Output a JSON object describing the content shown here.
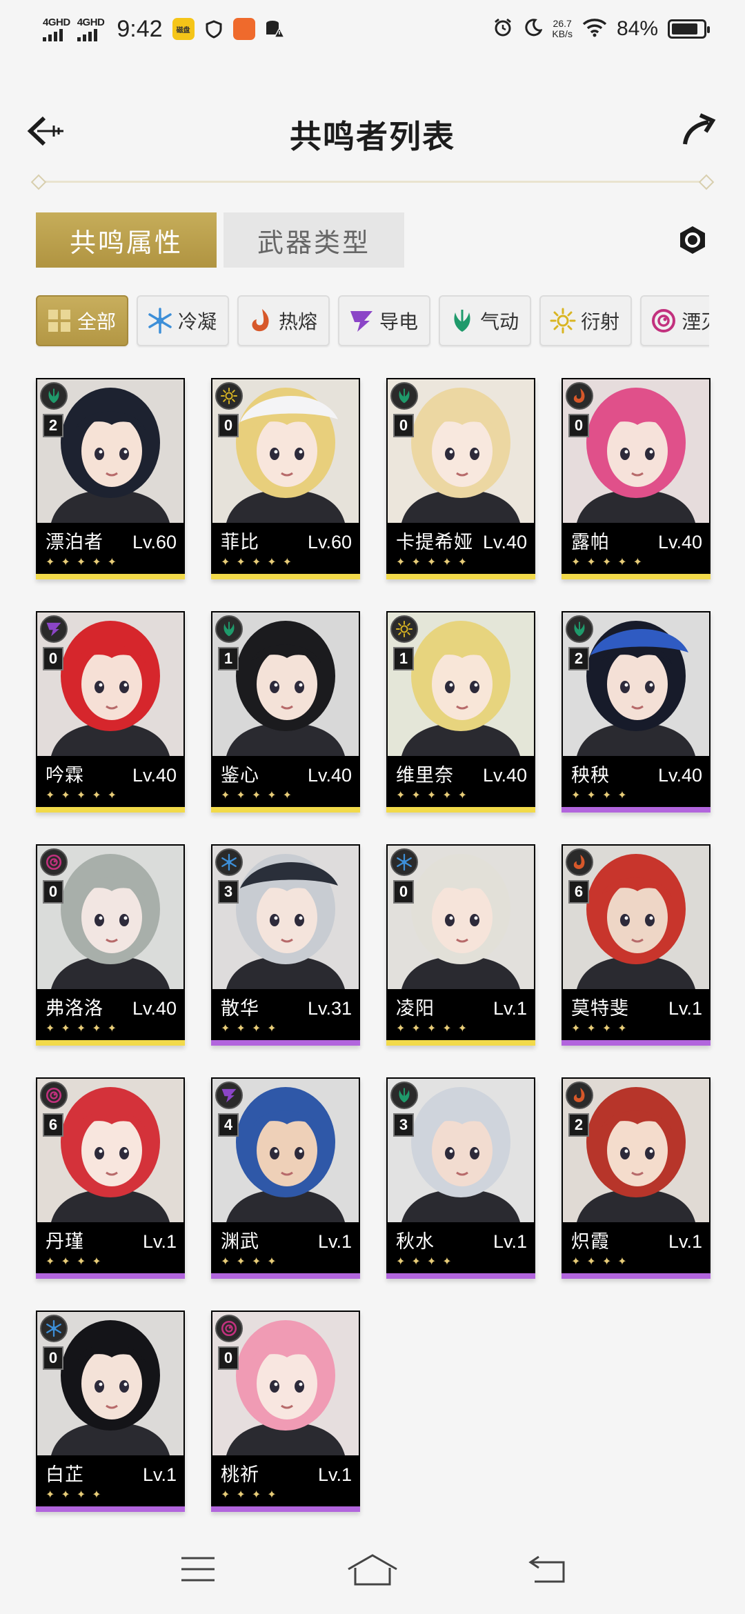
{
  "status": {
    "sim1": "4GHD",
    "sim2": "4GHD",
    "time": "9:42",
    "app1_badge": "磁盘",
    "speed_value": "26.7",
    "speed_unit": "KB/s",
    "battery": "84%",
    "battery_level": 0.84
  },
  "header": {
    "title": "共鸣者列表"
  },
  "tabs": [
    {
      "label": "共鸣属性",
      "active": true
    },
    {
      "label": "武器类型",
      "active": false
    }
  ],
  "filters": [
    {
      "label": "全部",
      "icon": "grid-icon",
      "active": true
    },
    {
      "label": "冷凝",
      "icon": "glacio-icon",
      "color": "#3d8fd8"
    },
    {
      "label": "热熔",
      "icon": "fusion-icon",
      "color": "#d7582a"
    },
    {
      "label": "导电",
      "icon": "electro-icon",
      "color": "#8b45c7"
    },
    {
      "label": "气动",
      "icon": "aero-icon",
      "color": "#1f9a6b"
    },
    {
      "label": "衍射",
      "icon": "spectro-icon",
      "color": "#d9b522"
    },
    {
      "label": "湮灭",
      "icon": "havoc-icon",
      "color": "#c2317e"
    }
  ],
  "characters": [
    {
      "name": "漂泊者",
      "level": "Lv.60",
      "rank": "2",
      "element": "aero",
      "stars": 5
    },
    {
      "name": "菲比",
      "level": "Lv.60",
      "rank": "0",
      "element": "spectro",
      "stars": 5
    },
    {
      "name": "卡提希娅",
      "level": "Lv.40",
      "rank": "0",
      "element": "aero",
      "stars": 5
    },
    {
      "name": "露帕",
      "level": "Lv.40",
      "rank": "0",
      "element": "fusion",
      "stars": 5
    },
    {
      "name": "吟霖",
      "level": "Lv.40",
      "rank": "0",
      "element": "electro",
      "stars": 5
    },
    {
      "name": "鉴心",
      "level": "Lv.40",
      "rank": "1",
      "element": "aero",
      "stars": 5
    },
    {
      "name": "维里奈",
      "level": "Lv.40",
      "rank": "1",
      "element": "spectro",
      "stars": 5
    },
    {
      "name": "秧秧",
      "level": "Lv.40",
      "rank": "2",
      "element": "aero",
      "stars": 4
    },
    {
      "name": "弗洛洛",
      "level": "Lv.40",
      "rank": "0",
      "element": "havoc",
      "stars": 5
    },
    {
      "name": "散华",
      "level": "Lv.31",
      "rank": "3",
      "element": "glacio",
      "stars": 4
    },
    {
      "name": "凌阳",
      "level": "Lv.1",
      "rank": "0",
      "element": "glacio",
      "stars": 5
    },
    {
      "name": "莫特斐",
      "level": "Lv.1",
      "rank": "6",
      "element": "fusion",
      "stars": 4
    },
    {
      "name": "丹瑾",
      "level": "Lv.1",
      "rank": "6",
      "element": "havoc",
      "stars": 4
    },
    {
      "name": "渊武",
      "level": "Lv.1",
      "rank": "4",
      "element": "electro",
      "stars": 4
    },
    {
      "name": "秋水",
      "level": "Lv.1",
      "rank": "3",
      "element": "aero",
      "stars": 4
    },
    {
      "name": "炽霞",
      "level": "Lv.1",
      "rank": "2",
      "element": "fusion",
      "stars": 4
    },
    {
      "name": "白芷",
      "level": "Lv.1",
      "rank": "0",
      "element": "glacio",
      "stars": 4
    },
    {
      "name": "桃祈",
      "level": "Lv.1",
      "rank": "0",
      "element": "havoc",
      "stars": 4
    }
  ],
  "portrait_styles": [
    {
      "hair": "#1d2230",
      "bg": "#dedad6",
      "skin": "#f6e2d6"
    },
    {
      "hair": "#e8cf7c",
      "bg": "#e6e2da",
      "skin": "#f8e6dc",
      "hat": "#f4f4f6"
    },
    {
      "hair": "#ecd7a2",
      "bg": "#ece6dc",
      "skin": "#f8e8de"
    },
    {
      "hair": "#e0508a",
      "bg": "#e6dcdc",
      "skin": "#f6e2da"
    },
    {
      "hair": "#d6262c",
      "bg": "#e2dcda",
      "skin": "#f6e0d6"
    },
    {
      "hair": "#1b1b1e",
      "bg": "#d8d8d8",
      "skin": "#f4e2d8"
    },
    {
      "hair": "#e7d47e",
      "bg": "#e4e6d8",
      "skin": "#f8e6d8"
    },
    {
      "hair": "#171b2a",
      "bg": "#dcdcdc",
      "skin": "#f4e0d6",
      "hat": "#2f5bc2"
    },
    {
      "hair": "#a8afaa",
      "bg": "#dadcda",
      "skin": "#f2e6e2"
    },
    {
      "hair": "#c8ccd2",
      "bg": "#dedcdc",
      "skin": "#f4e4dc",
      "hat": "#2a2f3a"
    },
    {
      "hair": "#e2e0d8",
      "bg": "#e2e0dc",
      "skin": "#f6e4da"
    },
    {
      "hair": "#c8352c",
      "bg": "#dcdad6",
      "skin": "#eed6c6"
    },
    {
      "hair": "#d4323a",
      "bg": "#e2dcd6",
      "skin": "#f8e6de"
    },
    {
      "hair": "#2f58a8",
      "bg": "#dcdcdc",
      "skin": "#eed0b8"
    },
    {
      "hair": "#cfd4dc",
      "bg": "#e2e2e2",
      "skin": "#f2dcd0"
    },
    {
      "hair": "#b7352a",
      "bg": "#e0dad4",
      "skin": "#f4dccc"
    },
    {
      "hair": "#141418",
      "bg": "#dcdad8",
      "skin": "#f4e2d8"
    },
    {
      "hair": "#f09bb4",
      "bg": "#e6dede",
      "skin": "#f8e6e0"
    }
  ]
}
